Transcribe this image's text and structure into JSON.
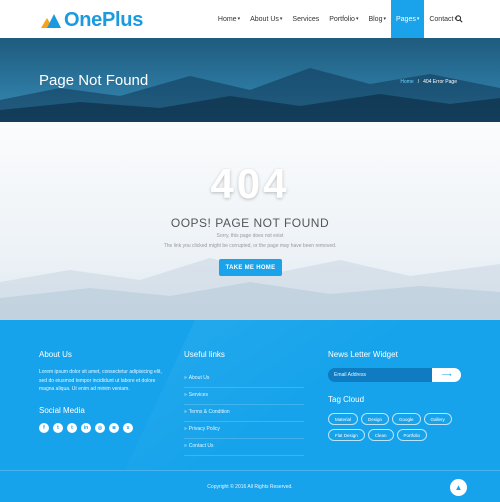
{
  "brand": {
    "name": "OnePlus",
    "accent": "#1aa3ea",
    "orange": "#f7a21b"
  },
  "nav": {
    "items": [
      {
        "label": "Home",
        "caret": "▾"
      },
      {
        "label": "About Us",
        "caret": "▾"
      },
      {
        "label": "Services",
        "caret": ""
      },
      {
        "label": "Portfolio",
        "caret": "▾"
      },
      {
        "label": "Blog",
        "caret": "▾"
      },
      {
        "label": "Pages",
        "caret": "▾"
      },
      {
        "label": "Contact",
        "caret": "▾"
      }
    ],
    "active": "Pages",
    "search_icon": "search-icon"
  },
  "banner": {
    "title": "Page Not Found",
    "breadcrumb_home": "Home",
    "breadcrumb_sep": "/",
    "breadcrumb_current": "404 Error Page"
  },
  "error": {
    "code": "404",
    "heading": "OOPS! PAGE NOT FOUND",
    "line1": "Sorry, this page does not exist",
    "line2": "The link you clicked might be corrupted, or the page may have been removed.",
    "button": "TAKE ME HOME"
  },
  "footer": {
    "about_title": "About Us",
    "about_text": "Lorem ipsum dolor sit amet, consectetur adipisicing elit, sed do eiusmod tempor incididunt ut labore et dolore magna aliqua. Ut enim ad minim veniam.",
    "social_title": "Social Media",
    "social": [
      {
        "icon": "facebook-icon",
        "glyph": "f"
      },
      {
        "icon": "twitter-icon",
        "glyph": "t"
      },
      {
        "icon": "tumblr-icon",
        "glyph": "t"
      },
      {
        "icon": "linkedin-icon",
        "glyph": "in"
      },
      {
        "icon": "dribbble-icon",
        "glyph": "◎"
      },
      {
        "icon": "instagram-icon",
        "glyph": "◙"
      },
      {
        "icon": "skype-icon",
        "glyph": "s"
      }
    ],
    "links_title": "Useful links",
    "links": [
      "About Us",
      "Services",
      "Terms & Condition",
      "Privacy Policy",
      "Contact Us"
    ],
    "newsletter_title": "News Letter Widget",
    "newsletter_placeholder": "Email Address",
    "newsletter_button": "⟶",
    "tag_title": "Tag Cloud",
    "tags": [
      "Material",
      "Design",
      "Google",
      "Gallery",
      "Flat Design",
      "Clean",
      "Portfolio"
    ],
    "copyright": "Copyright © 2016 All Rights Reserved.",
    "to_top": "▲"
  }
}
